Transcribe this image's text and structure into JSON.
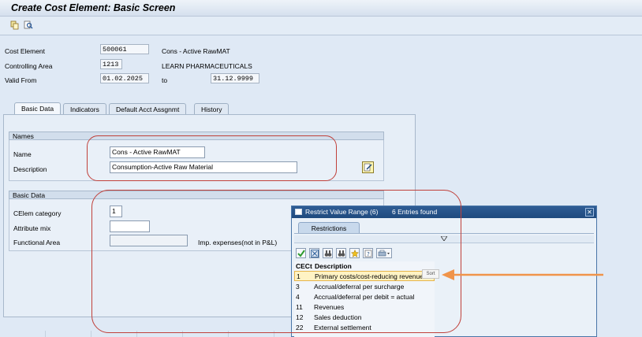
{
  "window": {
    "title": "Create Cost Element: Basic Screen"
  },
  "toolbar": {
    "icons": [
      "copy-icon",
      "search-icon"
    ]
  },
  "header": {
    "cost_element_label": "Cost Element",
    "cost_element_value": "500061",
    "cost_element_desc": "Cons - Active RawMAT",
    "controlling_area_label": "Controlling Area",
    "controlling_area_value": "1213",
    "controlling_area_desc": "LEARN PHARMACEUTICALS",
    "valid_from_label": "Valid From",
    "valid_from_value": "01.02.2025",
    "to_label": "to",
    "valid_to_value": "31.12.9999"
  },
  "tabs": [
    {
      "label": "Basic Data",
      "active": true
    },
    {
      "label": "Indicators",
      "active": false
    },
    {
      "label": "Default Acct Assgnmt",
      "active": false
    },
    {
      "label": "History",
      "active": false
    }
  ],
  "names_group": {
    "title": "Names",
    "name_label": "Name",
    "name_value": "Cons - Active RawMAT",
    "description_label": "Description",
    "description_value": "Consumption-Active Raw Material"
  },
  "basic_group": {
    "title": "Basic Data",
    "celem_category_label": "CElem category",
    "celem_category_value": "1",
    "attribute_mix_label": "Attribute mix",
    "attribute_mix_value": "",
    "functional_area_label": "Functional Area",
    "functional_area_value": "",
    "hint_text": "Imp. expenses(not in P&L)"
  },
  "popup": {
    "title": "Restrict Value Range (6)",
    "entries_found": "6 Entries found",
    "tab_label": "Restrictions",
    "col_code": "CECt",
    "col_desc": "Description",
    "tooltip": "Sort",
    "rows": [
      {
        "code": "1",
        "desc": "Primary costs/cost-reducing revenues",
        "selected": true
      },
      {
        "code": "3",
        "desc": "Accrual/deferral per surcharge",
        "selected": false
      },
      {
        "code": "4",
        "desc": "Accrual/deferral per debit = actual",
        "selected": false
      },
      {
        "code": "11",
        "desc": "Revenues",
        "selected": false
      },
      {
        "code": "12",
        "desc": "Sales deduction",
        "selected": false
      },
      {
        "code": "22",
        "desc": "External settlement",
        "selected": false
      }
    ]
  },
  "colors": {
    "annotation_red": "#c0403a",
    "annotation_arrow": "#f0944a",
    "popup_title_bg": "#1f4a7e",
    "selected_row": "#fff3c4"
  }
}
